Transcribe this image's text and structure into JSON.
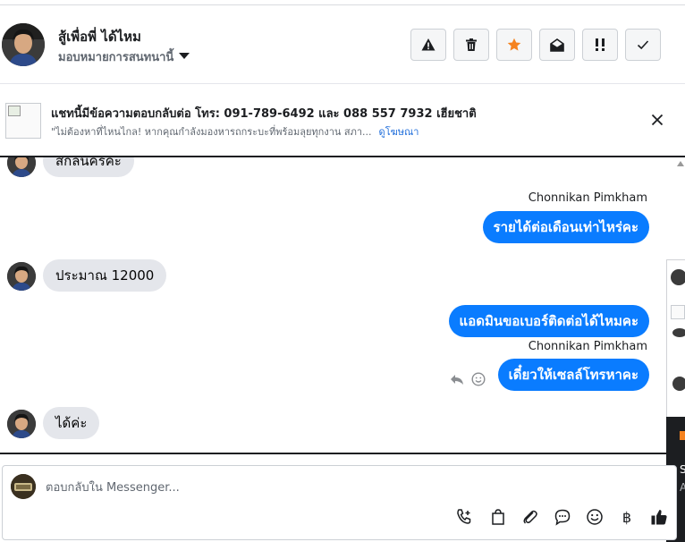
{
  "header": {
    "contact_name": "สู้เพื่อพี่ ได้ไหม",
    "assign_label": "มอบหมายการสนทนานี้",
    "actions": [
      {
        "icon": "warning-icon",
        "label": "Spam"
      },
      {
        "icon": "trash-icon",
        "label": "Delete"
      },
      {
        "icon": "star-icon",
        "label": "Star"
      },
      {
        "icon": "mail-open-icon",
        "label": "Mark unread"
      },
      {
        "icon": "follow-up-icon",
        "label": "Follow up"
      },
      {
        "icon": "check-icon",
        "label": "Done"
      }
    ]
  },
  "banner": {
    "title": "แชทนี้มีข้อความตอบกลับต่อ โทร: 091-789-6492 และ 088 557 7932 เฮียชาติ",
    "subtitle": "\"ไม่ต้องหาที่ไหนไกล! หากคุณกำลังมองหารถกระบะที่พร้อมลุยทุกงาน สภา...",
    "link": "ดูโฆษณา"
  },
  "thread": {
    "messages": [
      {
        "direction": "in",
        "text": "สกลนครคะ"
      },
      {
        "direction": "out",
        "sender": "Chonnikan Pimkham",
        "text": "รายได้ต่อเดือนเท่าไหร่คะ"
      },
      {
        "direction": "in",
        "text": "ประมาณ 12000"
      },
      {
        "direction": "out",
        "text": "แอดมินขอเบอร์ติดต่อได้ไหมคะ"
      },
      {
        "direction": "out",
        "sender": "Chonnikan Pimkham",
        "text": "เดี๋ยวให้เซลล์โทรหาคะ"
      },
      {
        "direction": "in",
        "text": "ได้ค่ะ"
      }
    ]
  },
  "side_panel": {
    "letters": [
      "S",
      "A"
    ]
  },
  "composer": {
    "placeholder": "ตอบกลับใน Messenger...",
    "value": "",
    "tools": [
      "phone-add-icon",
      "shopping-bag-icon",
      "paperclip-icon",
      "saved-reply-icon",
      "emoji-icon",
      "baht-icon",
      "thumbs-up-icon"
    ]
  },
  "colors": {
    "outgoing_bubble": "#0a7cff",
    "incoming_bubble": "#e4e6eb",
    "star": "#f5821f",
    "link": "#216fdb"
  }
}
